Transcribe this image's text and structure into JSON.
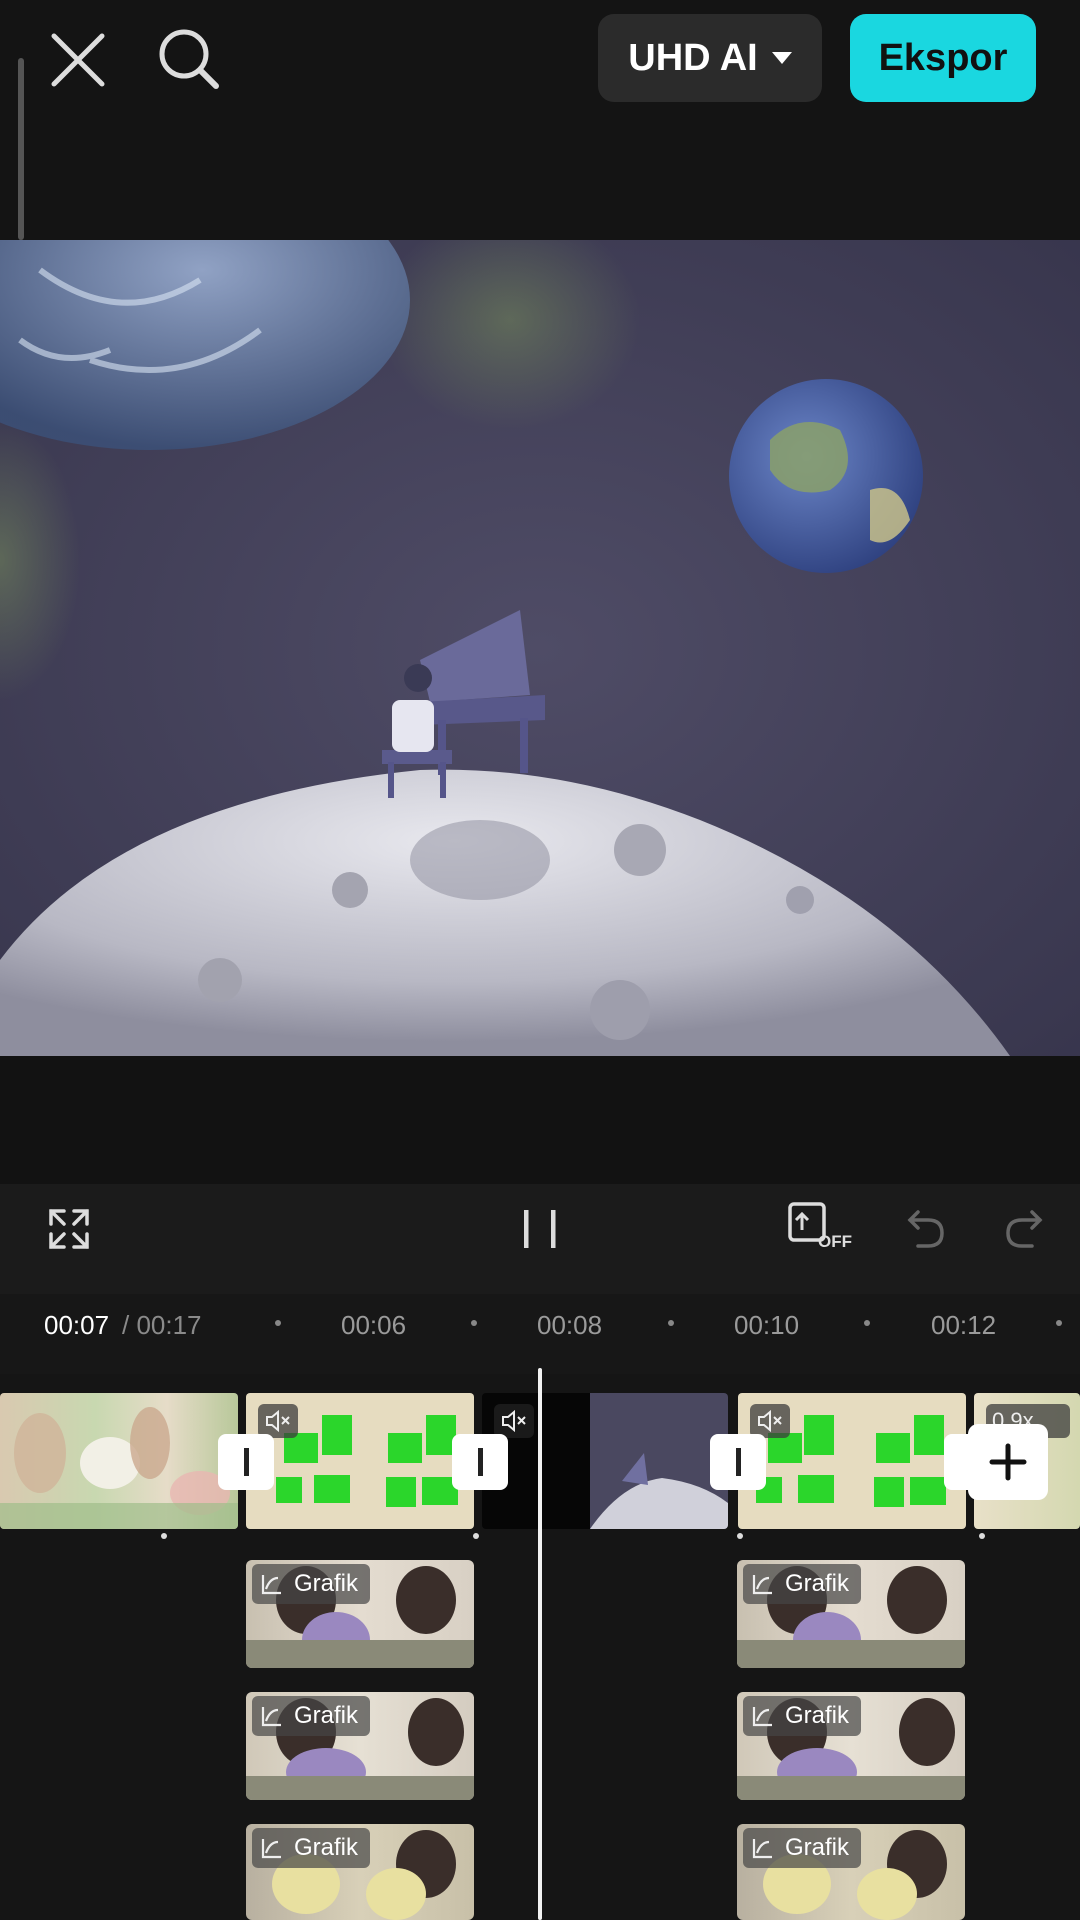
{
  "header": {
    "quality_label": "UHD AI",
    "export_label": "Ekspor"
  },
  "playback": {
    "current_time": "00:07",
    "total_time": "/ 00:17",
    "ruler_labels": [
      "00:06",
      "00:08",
      "00:10",
      "00:12"
    ]
  },
  "controls": {
    "sync_badge": "OFF"
  },
  "tracks": {
    "speed_label": "0.9x",
    "overlay_label": "Grafik"
  },
  "colors": {
    "accent": "#1ad7e0",
    "background": "#151515",
    "green_screen": "#2bd62b"
  },
  "icons": [
    "close-icon",
    "search-icon",
    "chevron-down-icon",
    "fullscreen-icon",
    "pause-icon",
    "sync-off-icon",
    "undo-icon",
    "redo-icon",
    "mute-icon",
    "add-icon",
    "graph-icon"
  ]
}
